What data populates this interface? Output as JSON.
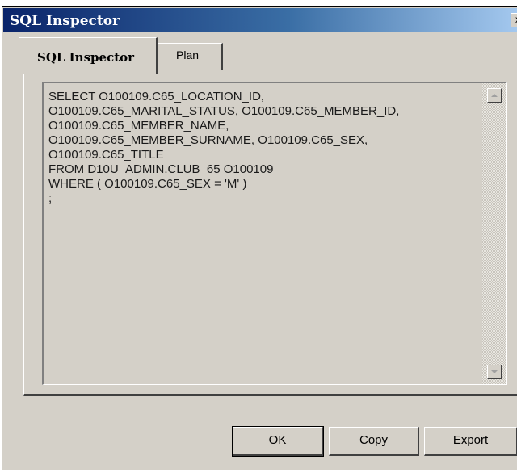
{
  "window": {
    "title": "SQL Inspector",
    "close_glyph": "x"
  },
  "tabs": [
    {
      "label": "SQL Inspector",
      "active": true
    },
    {
      "label": "Plan",
      "active": false
    }
  ],
  "sql_text": "SELECT O100109.C65_LOCATION_ID,\nO100109.C65_MARITAL_STATUS, O100109.C65_MEMBER_ID,\nO100109.C65_MEMBER_NAME,\nO100109.C65_MEMBER_SURNAME, O100109.C65_SEX,\nO100109.C65_TITLE\nFROM D10U_ADMIN.CLUB_65 O100109\nWHERE ( O100109.C65_SEX = 'M' )\n;",
  "scrollbar": {
    "up_icon": "arrow-up-icon",
    "down_icon": "arrow-down-icon"
  },
  "buttons": {
    "ok": "OK",
    "copy": "Copy",
    "export": "Export"
  },
  "colors": {
    "title_gradient_start": "#0a246a",
    "title_gradient_end": "#a6caf0",
    "dialog_face": "#d4d0c8"
  }
}
